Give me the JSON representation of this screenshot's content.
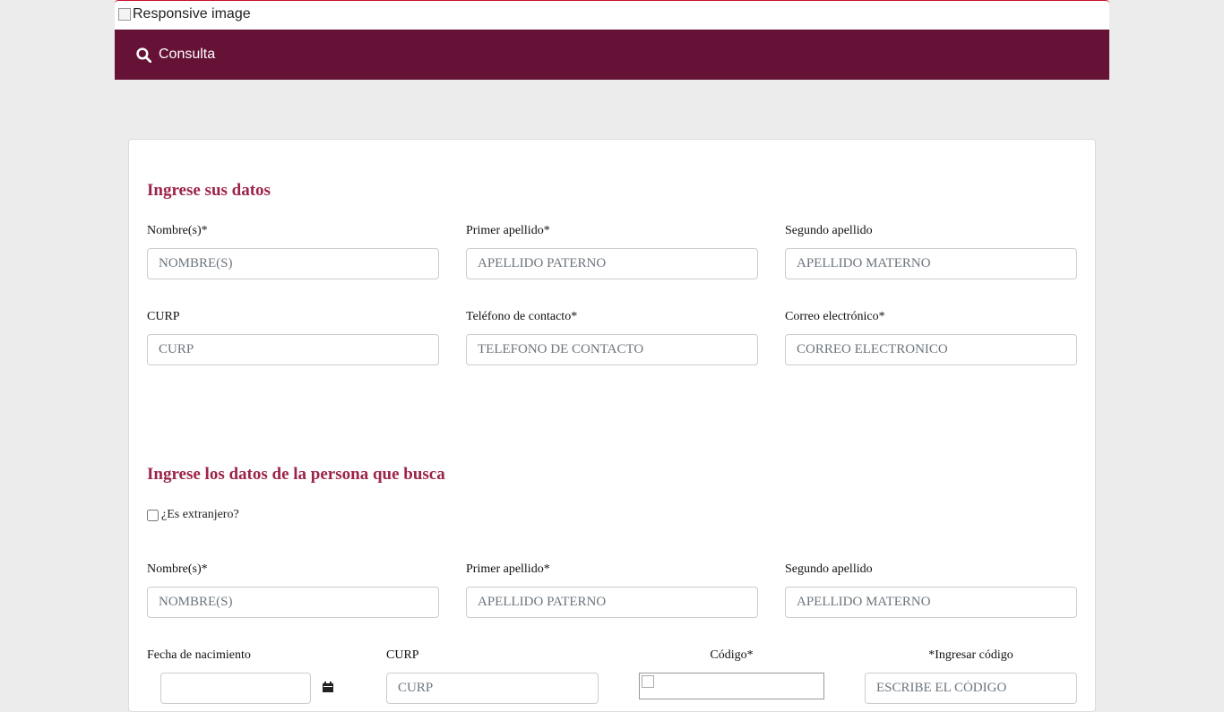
{
  "header": {
    "banner_alt": "Responsive image"
  },
  "nav": {
    "consulta_label": "Consulta",
    "icon": "search-icon"
  },
  "colors": {
    "nav_bg": "#651236",
    "title": "#9d2449",
    "page_bg": "#ececec"
  },
  "section1": {
    "title": "Ingrese sus datos",
    "nombre_label": "Nombre(s)*",
    "nombre_placeholder": "NOMBRE(S)",
    "primer_label": "Primer apellido*",
    "primer_placeholder": "APELLIDO PATERNO",
    "segundo_label": "Segundo apellido",
    "segundo_placeholder": "APELLIDO MATERNO",
    "curp_label": "CURP",
    "curp_placeholder": "CURP",
    "telefono_label": "Teléfono de contacto*",
    "telefono_placeholder": "TELEFONO DE CONTACTO",
    "correo_label": "Correo electrónico*",
    "correo_placeholder": "CORREO ELECTRONICO"
  },
  "section2": {
    "title": "Ingrese los datos de la persona que busca",
    "extranjero_label": "¿Es extranjero?",
    "nombre_label": "Nombre(s)*",
    "nombre_placeholder": "NOMBRE(S)",
    "primer_label": "Primer apellido*",
    "primer_placeholder": "APELLIDO PATERNO",
    "segundo_label": "Segundo apellido",
    "segundo_placeholder": "APELLIDO MATERNO",
    "fecha_label": "Fecha de nacimiento",
    "curp_label": "CURP",
    "curp_placeholder": "CURP",
    "codigo_label": "Código*",
    "ingresar_label": "*Ingresar código",
    "ingresar_placeholder": "ESCRIBE EL CÓDIGO"
  }
}
